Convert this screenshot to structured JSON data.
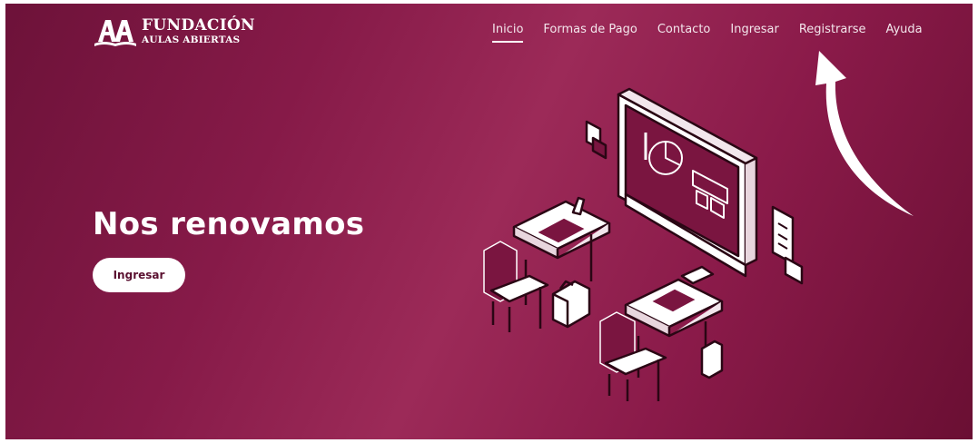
{
  "brand": {
    "line1": "FUNDACIÓN",
    "line2": "AULAS ABIERTAS",
    "mark": "AA"
  },
  "nav": {
    "items": [
      {
        "label": "Inicio",
        "active": true
      },
      {
        "label": "Formas de Pago"
      },
      {
        "label": "Contacto"
      },
      {
        "label": "Ingresar"
      },
      {
        "label": "Registrarse"
      },
      {
        "label": "Ayuda"
      }
    ]
  },
  "hero": {
    "title": "Nos renovamos",
    "button_label": "Ingresar"
  },
  "colors": {
    "primary": "#861a48",
    "dark": "#6a0f33",
    "text": "#ffffff"
  },
  "icons": [
    "book-logo-icon",
    "classroom-illustration",
    "curved-arrow-icon"
  ]
}
